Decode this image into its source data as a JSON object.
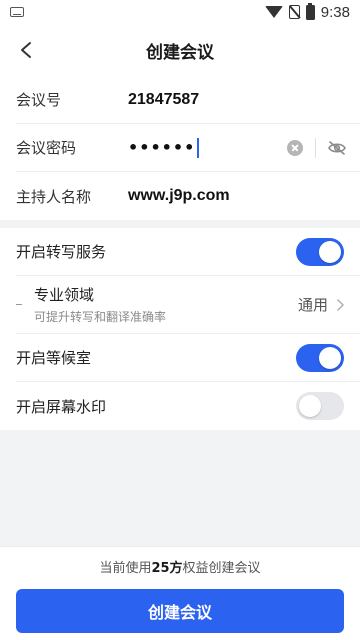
{
  "status_bar": {
    "time": "9:38",
    "icons": [
      "keyboard-icon",
      "wifi-icon",
      "no-sim-icon",
      "battery-icon"
    ]
  },
  "header": {
    "title": "创建会议",
    "back_icon": "chevron-left-icon"
  },
  "meeting_info": {
    "meeting_id_label": "会议号",
    "meeting_id_value": "21847587",
    "password_label": "会议密码",
    "password_value": "••••••",
    "host_label": "主持人名称",
    "host_value": "www.j9p.com"
  },
  "options": {
    "transcription": {
      "label": "开启转写服务",
      "enabled": true
    },
    "domain": {
      "title": "专业领域",
      "description": "可提升转写和翻译准确率",
      "value": "通用"
    },
    "waiting_room": {
      "label": "开启等候室",
      "enabled": true
    },
    "watermark": {
      "label": "开启屏幕水印",
      "enabled": false
    }
  },
  "footer": {
    "note_prefix": "当前使用",
    "note_highlight": "25方",
    "note_suffix": "权益创建会议",
    "button_label": "创建会议"
  },
  "colors": {
    "primary": "#2b62f0",
    "background": "#f2f3f5",
    "switch_off": "#e6e7ea"
  }
}
